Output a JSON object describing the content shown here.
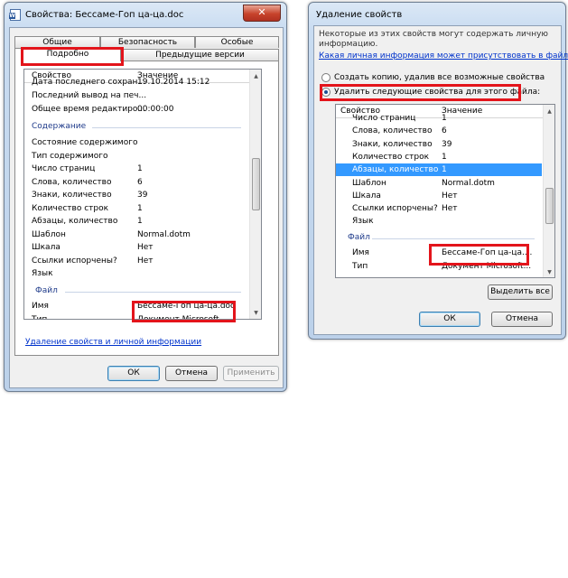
{
  "props_window": {
    "title": "Свойства: Бессаме-Гоп ца-ца.doc",
    "close_glyph": "✕",
    "tabs_top": [
      "Общие",
      "Безопасность",
      "Особые"
    ],
    "tabs_bottom": [
      "Подробно",
      "Предыдущие версии"
    ],
    "header": {
      "property": "Свойство",
      "value": "Значение"
    },
    "rows_top": [
      {
        "p": "Дата последнего сохран...",
        "v": "19.10.2014 15:12"
      },
      {
        "p": "Последний вывод на печ...",
        "v": ""
      },
      {
        "p": "Общее время редактиро...",
        "v": "00:00:00"
      }
    ],
    "group_content": "Содержание",
    "rows_content": [
      {
        "p": "Состояние содержимого",
        "v": ""
      },
      {
        "p": "Тип содержимого",
        "v": ""
      },
      {
        "p": "Число страниц",
        "v": "1"
      },
      {
        "p": "Слова, количество",
        "v": "6"
      },
      {
        "p": "Знаки, количество",
        "v": "39"
      },
      {
        "p": "Количество строк",
        "v": "1"
      },
      {
        "p": "Абзацы, количество",
        "v": "1"
      },
      {
        "p": "Шаблон",
        "v": "Normal.dotm"
      },
      {
        "p": "Шкала",
        "v": "Нет"
      },
      {
        "p": "Ссылки испорчены?",
        "v": "Нет"
      },
      {
        "p": "Язык",
        "v": ""
      }
    ],
    "group_file": "Файл",
    "rows_file": [
      {
        "p": "Имя",
        "v": "Бессаме-Гоп ца-ца.doc"
      },
      {
        "p": "Тип",
        "v": "Документ Microsoft ..."
      }
    ],
    "remove_link": "Удаление свойств и личной информации",
    "buttons": {
      "ok": "ОК",
      "cancel": "Отмена",
      "apply": "Применить"
    }
  },
  "remove_window": {
    "title": "Удаление свойств",
    "intro": "Некоторые из этих свойств могут содержать личную информацию.",
    "intro_line1": "Некоторые из этих свойств могут содержать личную",
    "intro_line2": "информацию.",
    "link": "Какая личная информация может присутствовать в файле?",
    "option_copy": "Создать копию, удалив все возможные свойства",
    "option_remove": "Удалить следующие свойства для этого файла:",
    "header": {
      "property": "Свойство",
      "value": "Значение"
    },
    "rows_content": [
      {
        "p": "Число страниц",
        "v": "1"
      },
      {
        "p": "Слова, количество",
        "v": "6"
      },
      {
        "p": "Знаки, количество",
        "v": "39"
      },
      {
        "p": "Количество строк",
        "v": "1"
      },
      {
        "p": "Абзацы, количество",
        "v": "1"
      },
      {
        "p": "Шаблон",
        "v": "Normal.dotm"
      },
      {
        "p": "Шкала",
        "v": "Нет"
      },
      {
        "p": "Ссылки испорчены?",
        "v": "Нет"
      },
      {
        "p": "Язык",
        "v": ""
      }
    ],
    "group_file": "Файл",
    "rows_file": [
      {
        "p": "Имя",
        "v": "Бессаме-Гоп ца-ца...."
      },
      {
        "p": "Тип",
        "v": "Документ Microsoft..."
      }
    ],
    "buttons": {
      "select_all": "Выделить все",
      "ok": "ОК",
      "cancel": "Отмена"
    }
  },
  "colors": {
    "highlight": "#e3141b",
    "selection": "#3399ff",
    "group_text": "#1e3a8a",
    "link": "#0033cc"
  },
  "icons": {
    "doc_icon": "word-document-icon",
    "close": "close-icon"
  }
}
